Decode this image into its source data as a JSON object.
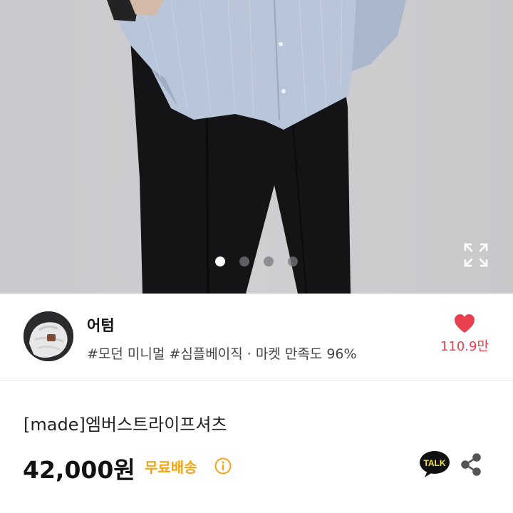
{
  "gallery": {
    "slide_count": 4,
    "active_slide": 1,
    "expand_icon": "expand-icon"
  },
  "seller": {
    "name": "어텀",
    "tags_text": "#모던 미니멀 #심플베이직 · 마켓 만족도 96%",
    "like_count": "110.9만",
    "like_color": "#e8404f",
    "heart_icon": "heart-icon"
  },
  "product": {
    "title": "[made]엠버스트라이프셔츠",
    "price": "42,000원",
    "shipping": "무료배송",
    "shipping_color": "#f2a515",
    "talk_label": "TALK",
    "share_icon": "share-icon",
    "info_icon": "info-icon"
  }
}
